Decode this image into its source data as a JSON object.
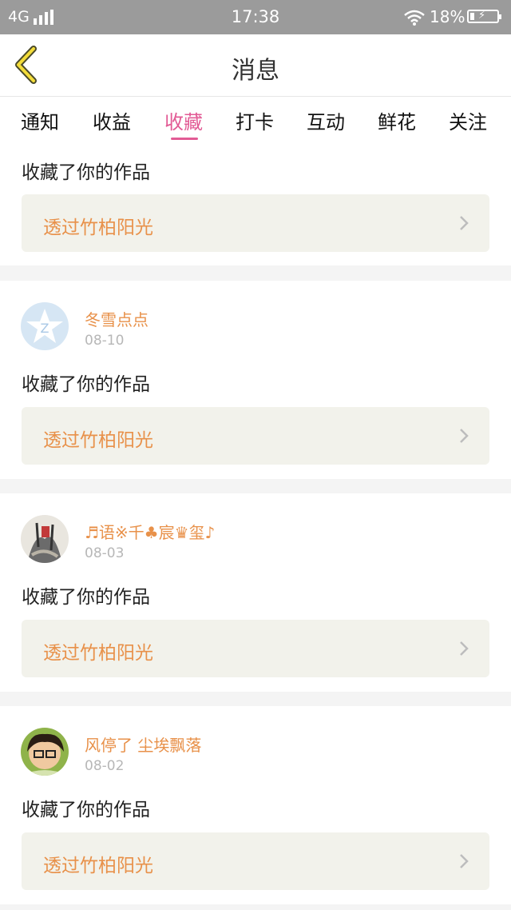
{
  "status_bar": {
    "network": "4G",
    "time": "17:38",
    "battery": "18%"
  },
  "header": {
    "title": "消息"
  },
  "tabs": [
    {
      "label": "通知"
    },
    {
      "label": "收益"
    },
    {
      "label": "收藏",
      "active": true
    },
    {
      "label": "打卡"
    },
    {
      "label": "互动"
    },
    {
      "label": "鲜花"
    },
    {
      "label": "关注"
    }
  ],
  "items": [
    {
      "action": "收藏了你的作品",
      "work_title": "透过竹柏阳光"
    },
    {
      "user": "冬雪点点",
      "date": "08-10",
      "action": "收藏了你的作品",
      "work_title": "透过竹柏阳光"
    },
    {
      "user": "♬语※千♣宸♛玺♪",
      "date": "08-03",
      "action": "收藏了你的作品",
      "work_title": "透过竹柏阳光"
    },
    {
      "user": "风停了 尘埃飘落",
      "date": "08-02",
      "action": "收藏了你的作品",
      "work_title": "透过竹柏阳光"
    }
  ],
  "colors": {
    "accent": "#e25b95",
    "name": "#e8914a",
    "work_bg": "#f2f2eb"
  },
  "icons": {
    "back": "chevron-left-icon",
    "item": "chevron-right-icon"
  }
}
